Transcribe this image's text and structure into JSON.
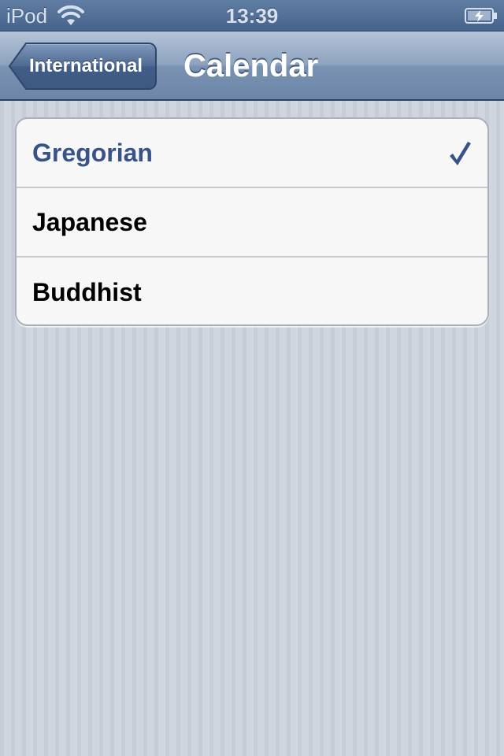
{
  "status_bar": {
    "carrier": "iPod",
    "time": "13:39",
    "icons": [
      "wifi-icon",
      "battery-charging-icon"
    ]
  },
  "nav_bar": {
    "back_label": "International",
    "title": "Calendar"
  },
  "calendar_options": [
    {
      "label": "Gregorian",
      "selected": true
    },
    {
      "label": "Japanese",
      "selected": false
    },
    {
      "label": "Buddhist",
      "selected": false
    }
  ],
  "colors": {
    "selected_text": "#385487",
    "nav_bar": "#7a92b2",
    "background": "#cbd2dc"
  }
}
